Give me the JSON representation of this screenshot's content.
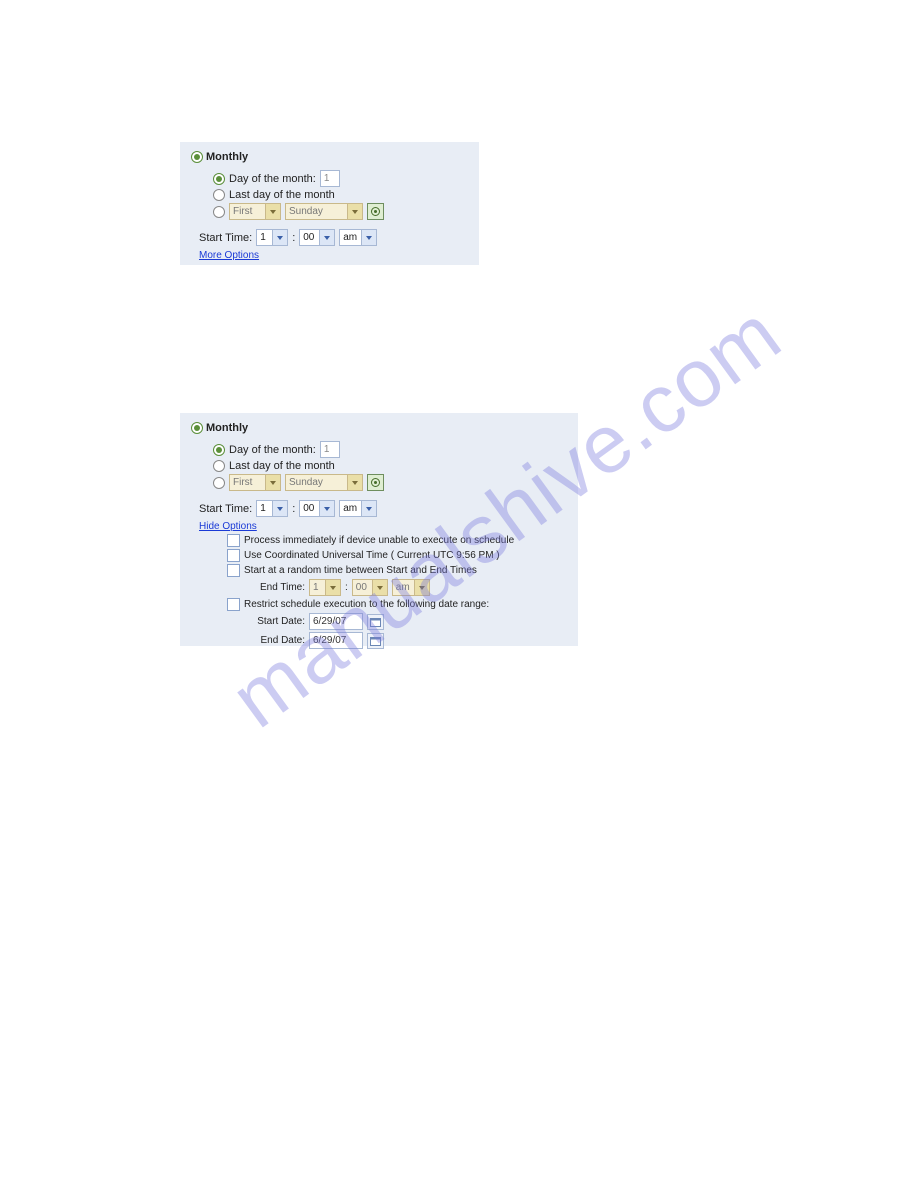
{
  "watermark": "manualshive.com",
  "panel1": {
    "title": "Monthly",
    "day_of_month_label": "Day of the month:",
    "day_of_month_value": "1",
    "last_day_label": "Last day of the month",
    "ordinal_select": "First",
    "day_select": "Sunday",
    "start_time_label": "Start Time:",
    "hour": "1",
    "minute": "00",
    "ampm": "am",
    "options_link": "More Options"
  },
  "panel2": {
    "title": "Monthly",
    "day_of_month_label": "Day of the month:",
    "day_of_month_value": "1",
    "last_day_label": "Last day of the month",
    "ordinal_select": "First",
    "day_select": "Sunday",
    "start_time_label": "Start Time:",
    "hour": "1",
    "minute": "00",
    "ampm": "am",
    "options_link": "Hide Options",
    "opt_process": "Process immediately if device unable to execute on schedule",
    "opt_utc": "Use Coordinated Universal Time ( Current UTC 9:56 PM )",
    "opt_random": "Start at a random time between Start and End Times",
    "end_time_label": "End Time:",
    "end_hour": "1",
    "end_minute": "00",
    "end_ampm": "am",
    "opt_restrict": "Restrict schedule execution to the following date range:",
    "start_date_label": "Start Date:",
    "start_date_value": "6/29/07",
    "end_date_label": "End Date:",
    "end_date_value": "6/29/07"
  }
}
